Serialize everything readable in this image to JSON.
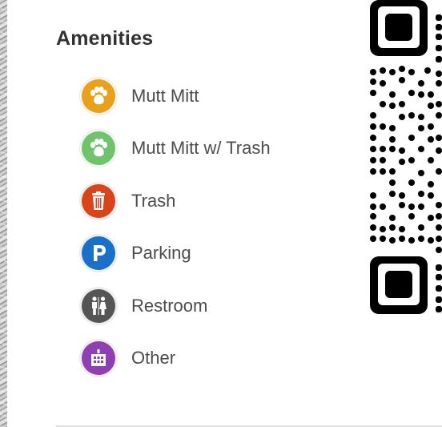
{
  "legend": {
    "title": "Amenities",
    "items": [
      {
        "label": "Mutt Mitt",
        "icon": "paw-icon",
        "color": "#e8a11a"
      },
      {
        "label": "Mutt Mitt w/ Trash",
        "icon": "paw-icon",
        "color": "#6fc36a"
      },
      {
        "label": "Trash",
        "icon": "trash-can-icon",
        "color": "#d9451b"
      },
      {
        "label": "Parking",
        "icon": "parking-icon",
        "color": "#1a6fc8"
      },
      {
        "label": "Restroom",
        "icon": "restroom-icon",
        "color": "#555555"
      },
      {
        "label": "Other",
        "icon": "building-icon",
        "color": "#8e3fb0"
      }
    ]
  },
  "qr_code": {
    "icon": "qr-code-icon",
    "color": "#000000"
  }
}
